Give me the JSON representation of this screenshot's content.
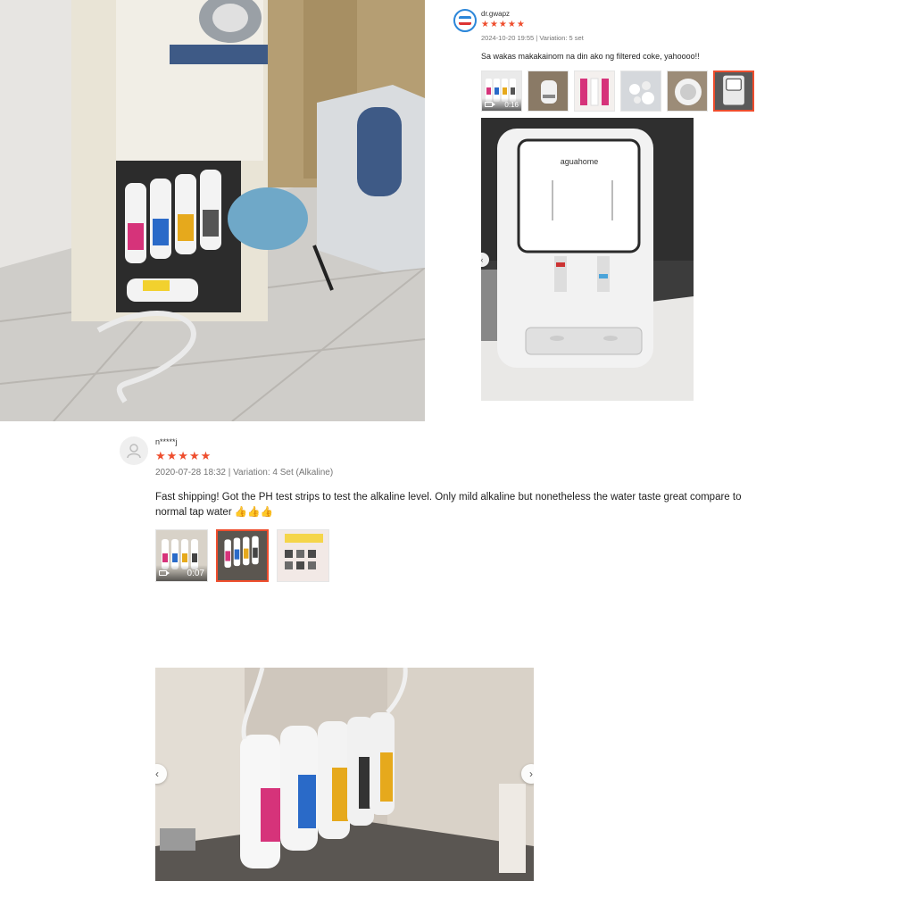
{
  "review1": {
    "username": "dr.gwapz",
    "stars": "★★★★★",
    "meta": "2024-10-20 19:55 | Variation: 5 set",
    "comment": "Sa wakas makakainom na din ako ng filtered coke, yahoooo!!",
    "thumbnails": [
      {
        "type": "video",
        "duration": "0:16",
        "selected": false
      },
      {
        "type": "image",
        "selected": false
      },
      {
        "type": "image",
        "selected": false
      },
      {
        "type": "image",
        "selected": false
      },
      {
        "type": "image",
        "selected": false
      },
      {
        "type": "image",
        "selected": true
      }
    ],
    "preview_brand": "aguahome"
  },
  "review2": {
    "username": "n*****j",
    "stars": "★★★★★",
    "meta": "2020-07-28 18:32 | Variation: 4 Set (Alkaline)",
    "comment": "Fast shipping! Got the PH test strips to test the alkaline level. Only mild alkaline but nonetheless the water taste great compare to normal tap water 👍👍👍",
    "thumbnails": [
      {
        "type": "video",
        "duration": "0:07",
        "selected": false
      },
      {
        "type": "image",
        "selected": true
      },
      {
        "type": "image",
        "selected": false
      }
    ]
  },
  "icons": {
    "prev": "‹",
    "next": "›",
    "user_avatar": "user-silhouette-icon",
    "video": "video-camera-icon"
  },
  "colors": {
    "star": "#ee4d2d",
    "selected_border": "#ee4d2d",
    "meta_text": "#757575"
  }
}
